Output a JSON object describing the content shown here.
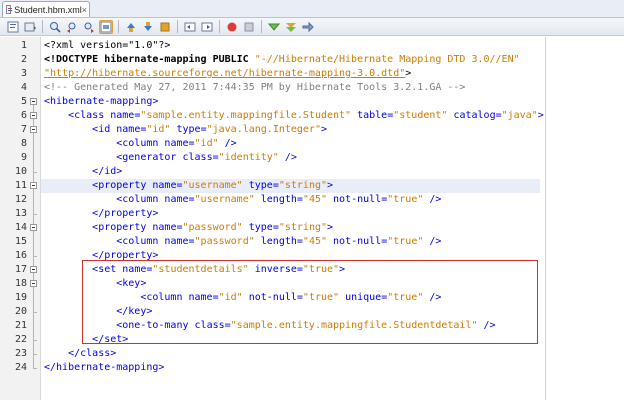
{
  "tab": {
    "title": "Student.hbm.xml",
    "close": "×"
  },
  "toolbar": {
    "buttons": [
      "source-view",
      "history-view",
      "search-icon",
      "find-previous",
      "find-next",
      "toggle-highlight",
      "previous-bookmark",
      "next-bookmark",
      "toggle-bookmark",
      "shift-left",
      "shift-right",
      "start-macro",
      "stop-macro",
      "check-xml",
      "validate-xml",
      "run-xsl"
    ]
  },
  "editor": {
    "line_numbers": [
      "1",
      "2",
      "3",
      "4",
      "5",
      "6",
      "7",
      "8",
      "9",
      "10",
      "11",
      "12",
      "13",
      "14",
      "15",
      "16",
      "17",
      "18",
      "19",
      "20",
      "21",
      "22",
      "23",
      "24"
    ],
    "current_line": 11,
    "lines": [
      [
        [
          "d",
          "<?xml version=\"1.0\"?>"
        ]
      ],
      [
        [
          "doc",
          "<!DOCTYPE hibernate-mapping PUBLIC "
        ],
        [
          "v",
          "\"-//Hibernate/Hibernate Mapping DTD 3.0//EN\""
        ]
      ],
      [
        [
          "l",
          "\"http://hibernate.sourceforge.net/hibernate-mapping-3.0.dtd\""
        ],
        [
          "d",
          ">"
        ]
      ],
      [
        [
          "c",
          "<!-- Generated May 27, 2011 7:44:35 PM by Hibernate Tools 3.2.1.GA -->"
        ]
      ],
      [
        [
          "t",
          "<hibernate-mapping>"
        ]
      ],
      [
        [
          "p",
          "    "
        ],
        [
          "t",
          "<class "
        ],
        [
          "a",
          "name="
        ],
        [
          "v",
          "\"sample.entity.mappingfile.Student\""
        ],
        [
          "a",
          " table="
        ],
        [
          "v",
          "\"student\""
        ],
        [
          "a",
          " catalog="
        ],
        [
          "v",
          "\"java\""
        ],
        [
          "t",
          ">"
        ]
      ],
      [
        [
          "p",
          "        "
        ],
        [
          "t",
          "<id "
        ],
        [
          "a",
          "name="
        ],
        [
          "v",
          "\"id\""
        ],
        [
          "a",
          " type="
        ],
        [
          "v",
          "\"java.lang.Integer\""
        ],
        [
          "t",
          ">"
        ]
      ],
      [
        [
          "p",
          "            "
        ],
        [
          "t",
          "<column "
        ],
        [
          "a",
          "name="
        ],
        [
          "v",
          "\"id\""
        ],
        [
          "t",
          " />"
        ]
      ],
      [
        [
          "p",
          "            "
        ],
        [
          "t",
          "<generator "
        ],
        [
          "a",
          "class="
        ],
        [
          "v",
          "\"identity\""
        ],
        [
          "t",
          " />"
        ]
      ],
      [
        [
          "p",
          "        "
        ],
        [
          "t",
          "</id>"
        ]
      ],
      [
        [
          "p",
          "        "
        ],
        [
          "t",
          "<property "
        ],
        [
          "a",
          "name="
        ],
        [
          "v",
          "\"username\""
        ],
        [
          "a",
          " type="
        ],
        [
          "v",
          "\"string\""
        ],
        [
          "t",
          ">"
        ]
      ],
      [
        [
          "p",
          "            "
        ],
        [
          "t",
          "<column "
        ],
        [
          "a",
          "name="
        ],
        [
          "v",
          "\"username\""
        ],
        [
          "a",
          " length="
        ],
        [
          "v",
          "\"45\""
        ],
        [
          "a",
          " not-null="
        ],
        [
          "v",
          "\"true\""
        ],
        [
          "t",
          " />"
        ]
      ],
      [
        [
          "p",
          "        "
        ],
        [
          "t",
          "</property>"
        ]
      ],
      [
        [
          "p",
          "        "
        ],
        [
          "t",
          "<property "
        ],
        [
          "a",
          "name="
        ],
        [
          "v",
          "\"password\""
        ],
        [
          "a",
          " type="
        ],
        [
          "v",
          "\"string\""
        ],
        [
          "t",
          ">"
        ]
      ],
      [
        [
          "p",
          "            "
        ],
        [
          "t",
          "<column "
        ],
        [
          "a",
          "name="
        ],
        [
          "v",
          "\"password\""
        ],
        [
          "a",
          " length="
        ],
        [
          "v",
          "\"45\""
        ],
        [
          "a",
          " not-null="
        ],
        [
          "v",
          "\"true\""
        ],
        [
          "t",
          " />"
        ]
      ],
      [
        [
          "p",
          "        "
        ],
        [
          "t",
          "</property>"
        ]
      ],
      [
        [
          "p",
          "        "
        ],
        [
          "t",
          "<set "
        ],
        [
          "a",
          "name="
        ],
        [
          "v",
          "\"studentdetails\""
        ],
        [
          "a",
          " inverse="
        ],
        [
          "v",
          "\"true\""
        ],
        [
          "t",
          ">"
        ]
      ],
      [
        [
          "p",
          "            "
        ],
        [
          "t",
          "<key>"
        ]
      ],
      [
        [
          "p",
          "                "
        ],
        [
          "t",
          "<column "
        ],
        [
          "a",
          "name="
        ],
        [
          "v",
          "\"id\""
        ],
        [
          "a",
          " not-null="
        ],
        [
          "v",
          "\"true\""
        ],
        [
          "a",
          " unique="
        ],
        [
          "v",
          "\"true\""
        ],
        [
          "t",
          " />"
        ]
      ],
      [
        [
          "p",
          "            "
        ],
        [
          "t",
          "</key>"
        ]
      ],
      [
        [
          "p",
          "            "
        ],
        [
          "t",
          "<one-to-many "
        ],
        [
          "a",
          "class="
        ],
        [
          "v",
          "\"sample.entity.mappingfile.Studentdetail\""
        ],
        [
          "t",
          " />"
        ]
      ],
      [
        [
          "p",
          "        "
        ],
        [
          "t",
          "</set>"
        ]
      ],
      [
        [
          "p",
          "    "
        ],
        [
          "t",
          "</class>"
        ]
      ],
      [
        [
          "t",
          "</hibernate-mapping>"
        ]
      ]
    ]
  },
  "colors": {
    "tag": "#0000e6",
    "value": "#ce7b00",
    "comment": "#808080",
    "highlight_box": "#d03030",
    "current_line_bg": "#e8edf8"
  }
}
